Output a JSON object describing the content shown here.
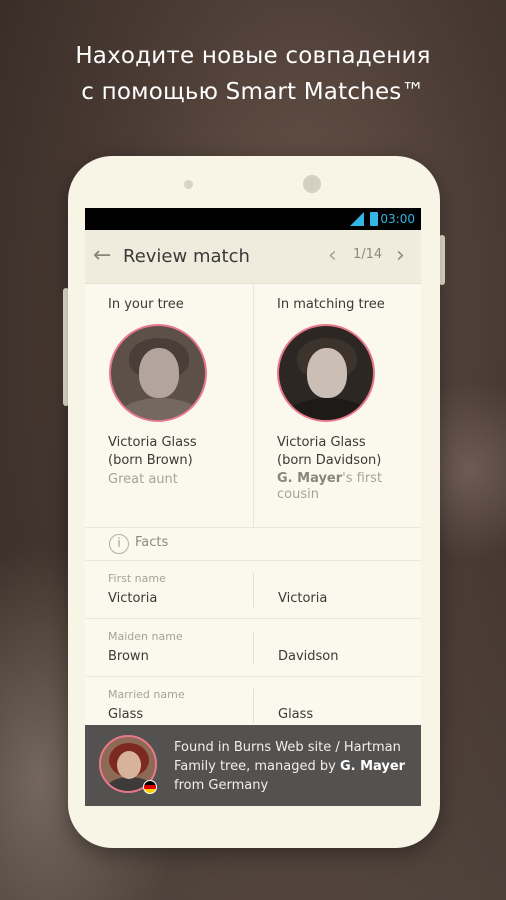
{
  "headline": {
    "line1": "Находите новые совпадения",
    "line2": "с помощью Smart Matches™"
  },
  "statusbar": {
    "time": "03:00"
  },
  "appbar": {
    "title": "Review match",
    "counter": "1/14",
    "back_icon": "arrow-left-icon",
    "prev_icon": "chevron-left-icon",
    "next_icon": "chevron-right-icon"
  },
  "compare": {
    "left": {
      "heading": "In your tree",
      "name_line1": "Victoria Glass",
      "name_line2": "(born Brown)",
      "relation": "Great aunt"
    },
    "right": {
      "heading": "In matching tree",
      "name_line1": "Victoria Glass",
      "name_line2": "(born Davidson)",
      "relation_owner": "G. Mayer",
      "relation_rest": "'s first cousin"
    }
  },
  "facts": {
    "heading": "Facts",
    "rows": [
      {
        "label": "First name",
        "left": "Victoria",
        "right": "Victoria"
      },
      {
        "label": "Maiden name",
        "left": "Brown",
        "right": "Davidson"
      },
      {
        "label": "Married name",
        "left": "Glass",
        "right": "Glass"
      }
    ]
  },
  "source": {
    "prefix": "Found in Burns Web site / Hartman Family tree, managed by ",
    "manager": "G. Mayer",
    "suffix": " from Germany"
  },
  "colors": {
    "accent_ring": "#e8798b",
    "status_blue": "#33b5e5",
    "source_bar": "#545250",
    "screen_bg": "#fbf8ed"
  }
}
